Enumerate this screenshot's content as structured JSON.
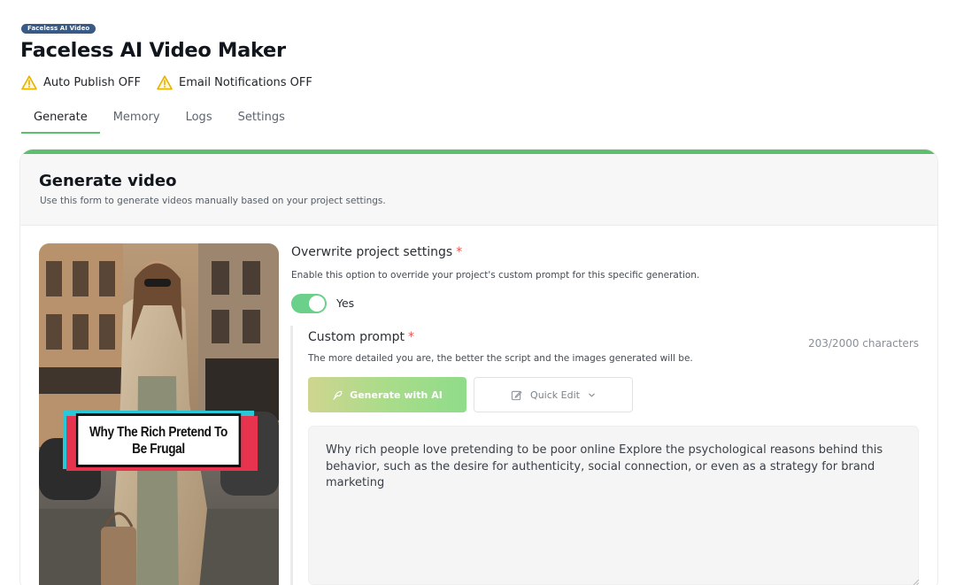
{
  "header": {
    "badge": "Faceless AI Video",
    "title": "Faceless AI Video Maker"
  },
  "status": [
    {
      "icon": "warning-triangle-icon",
      "label": "Auto Publish OFF"
    },
    {
      "icon": "warning-triangle-icon",
      "label": "Email Notifications OFF"
    }
  ],
  "tabs": [
    {
      "label": "Generate",
      "active": true
    },
    {
      "label": "Memory",
      "active": false
    },
    {
      "label": "Logs",
      "active": false
    },
    {
      "label": "Settings",
      "active": false
    }
  ],
  "card": {
    "title": "Generate video",
    "subtitle": "Use this form to generate videos manually based on your project settings."
  },
  "thumbnail": {
    "caption": "Why The Rich Pretend To Be Frugal"
  },
  "overwrite": {
    "label": "Overwrite project settings",
    "required_mark": "*",
    "help": "Enable this option to override your project's custom prompt for this specific generation.",
    "toggle_on": true,
    "toggle_label": "Yes"
  },
  "custom_prompt": {
    "label": "Custom prompt",
    "required_mark": "*",
    "char_count": "203/2000 characters",
    "help": "The more detailed you are, the better the script and the images generated will be.",
    "generate_button": "Generate with AI",
    "quick_edit_button": "Quick Edit",
    "value": "Why rich people love pretending to be poor online Explore the psychological reasons behind this behavior, such as the desire for authenticity, social connection, or even as a strategy for brand marketing"
  },
  "colors": {
    "accent": "#5cbf6e",
    "warning": "#e8b100",
    "required": "#e25656",
    "badge": "#3a5a86"
  }
}
